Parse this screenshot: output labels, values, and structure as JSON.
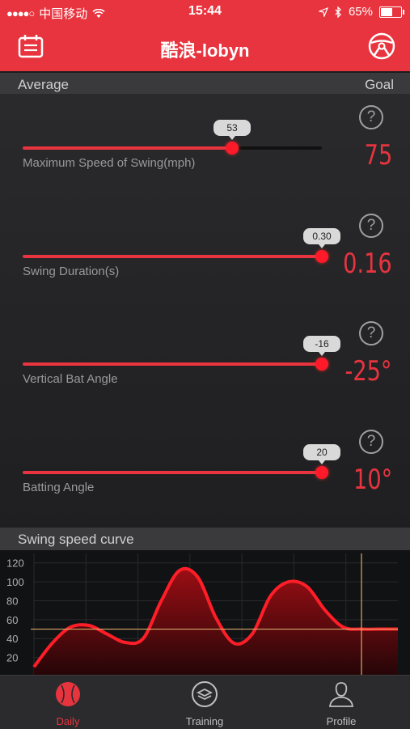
{
  "status_bar": {
    "carrier": "中国移动",
    "time": "15:44",
    "battery": "65%",
    "battery_level": 0.65
  },
  "nav": {
    "title": "酷浪-lobyn"
  },
  "headers": {
    "average": "Average",
    "goal": "Goal",
    "curve": "Swing speed curve"
  },
  "metrics": [
    {
      "label": "Maximum Speed of Swing(mph)",
      "value": "53",
      "fraction": 0.7,
      "goal": "75"
    },
    {
      "label": "Swing Duration(s)",
      "value": "0.30",
      "fraction": 1.0,
      "goal": "0.16"
    },
    {
      "label": "Vertical Bat Angle",
      "value": "-16",
      "fraction": 1.0,
      "goal": "-25°"
    },
    {
      "label": "Batting Angle",
      "value": "20",
      "fraction": 1.0,
      "goal": "10°"
    }
  ],
  "chart_data": {
    "type": "area",
    "title": "Swing speed curve",
    "y_ticks": [
      "120",
      "100",
      "80",
      "60",
      "40",
      "20"
    ],
    "ylim": [
      0,
      130
    ],
    "x": [
      0,
      1,
      2,
      3,
      4,
      5,
      6,
      7,
      8,
      9,
      10,
      11,
      12,
      13,
      14,
      15,
      16,
      17,
      18,
      19,
      20
    ],
    "values": [
      10,
      35,
      52,
      54,
      45,
      36,
      40,
      80,
      112,
      105,
      62,
      35,
      45,
      85,
      100,
      95,
      70,
      52,
      50,
      50,
      50
    ],
    "reference_line": 50,
    "grid": true,
    "colors": {
      "curve": "#ff1e28",
      "fill_top": "#9b0e14",
      "fill_bottom": "#240608",
      "reference": "#d9a86a"
    }
  },
  "tabs": [
    {
      "label": "Daily",
      "icon": "baseball-icon",
      "active": true
    },
    {
      "label": "Training",
      "icon": "layers-icon",
      "active": false
    },
    {
      "label": "Profile",
      "icon": "person-icon",
      "active": false
    }
  ],
  "colors": {
    "accent": "#e8343f",
    "background": "#1c1c1e"
  }
}
